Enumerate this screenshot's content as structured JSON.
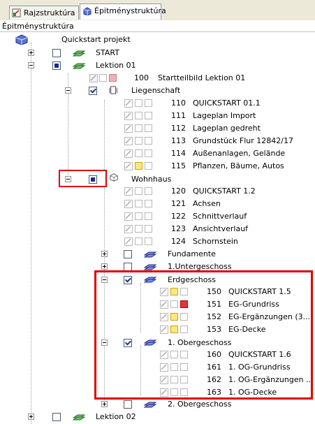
{
  "tabs": [
    {
      "label": "Rajzstruktúra",
      "icon": "drawing-structure-icon"
    },
    {
      "label": "Épitménystruktúra",
      "icon": "building-structure-icon"
    }
  ],
  "panel_title": "Épitménystruktúra",
  "tree": {
    "root": "Quickstart projekt",
    "nodes": {
      "start": "START",
      "lektion01": "Lektion 01",
      "n100_num": "100",
      "n100_label": "Startteilbild Lektion 01",
      "liegenschaft": "Liegenschaft",
      "n110_num": "110",
      "n110_label": "QUICKSTART 01.1",
      "n111_num": "111",
      "n111_label": "Lageplan Import",
      "n112_num": "112",
      "n112_label": "Lageplan gedreht",
      "n113_num": "113",
      "n113_label": "Grundstück Flur 12842/17",
      "n114_num": "114",
      "n114_label": "Außenanlagen, Gelände",
      "n115_num": "115",
      "n115_label": "Pflanzen, Bäume, Autos",
      "wohnhaus": "Wohnhaus",
      "n120_num": "120",
      "n120_label": "QUICKSTART 1.2",
      "n121_num": "121",
      "n121_label": "Achsen",
      "n122_num": "122",
      "n122_label": "Schnittverlauf",
      "n123_num": "123",
      "n123_label": "Ansichtverlauf",
      "n124_num": "124",
      "n124_label": "Schornstein",
      "fundamente": "Fundamente",
      "untergeschoss": "1.Untergeschoss",
      "erdgeschoss": "Erdgeschoss",
      "n150_num": "150",
      "n150_label": "QUICKSTART 1.5",
      "n151_num": "151",
      "n151_label": "EG-Grundriss",
      "n152_num": "152",
      "n152_label": "EG-Ergänzungen (3...",
      "n153_num": "153",
      "n153_label": "EG-Decke",
      "obergeschoss1": "1. Obergeschoss",
      "n160_num": "160",
      "n160_label": "QUICKSTART 1.6",
      "n161_num": "161",
      "n161_label": "1. OG-Grundriss",
      "n162_num": "162",
      "n162_label": "1. OG-Ergänzungen ...",
      "n163_num": "163",
      "n163_label": "1. OG-Decke",
      "obergeschoss2": "2. Obergeschoss",
      "lektion02": "Lektion 02"
    }
  },
  "colors": {
    "highlight": "#e00000",
    "folder_green": "#3a8a3a",
    "folder_blue": "#2c4aa8"
  }
}
